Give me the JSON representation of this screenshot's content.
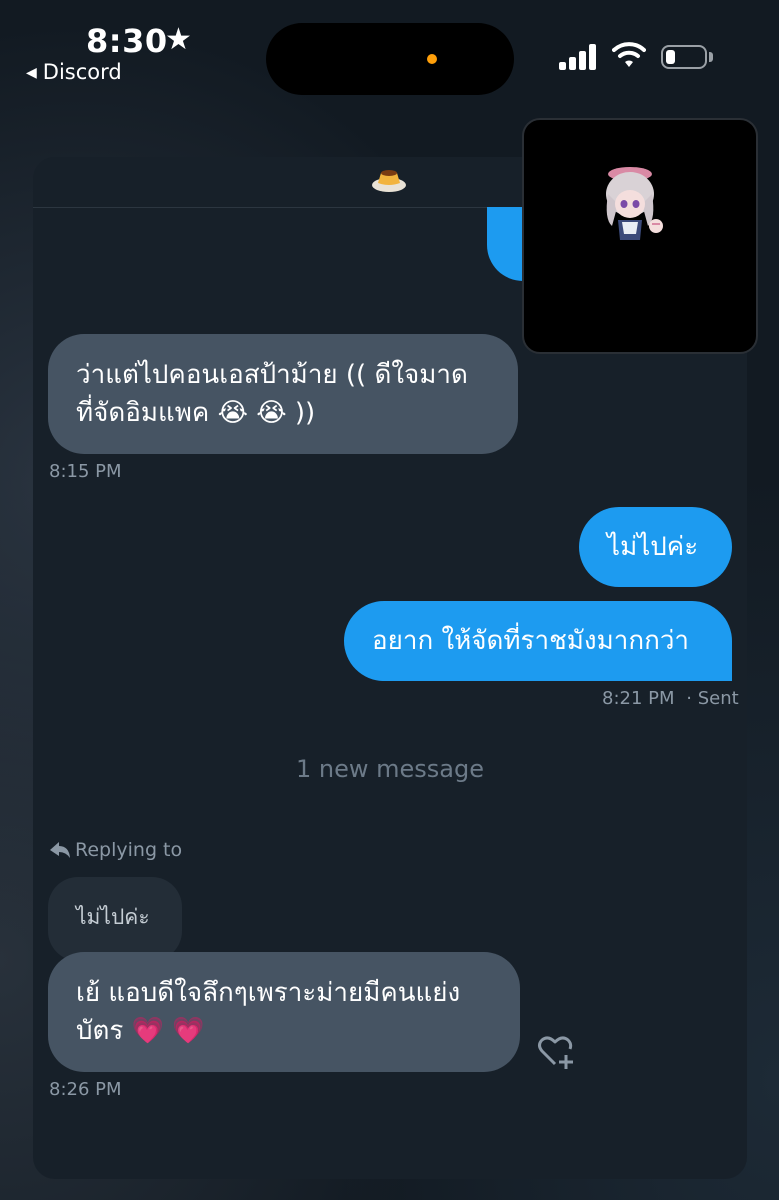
{
  "status_bar": {
    "time": "8:30",
    "star": "★",
    "back_app": "Discord",
    "dot_color": "#ff9f0a"
  },
  "header": {
    "avatar_icon": "flan-pudding-icon"
  },
  "messages": [
    {
      "direction": "in",
      "lines": [
        "ว่าแต่ไปคอนเอสป้าม้าย (( ดีใจมาด",
        "ที่จัดอิมแพค 😭 😭 ))"
      ],
      "time": "8:15 PM"
    },
    {
      "direction": "out",
      "text": "ไม่ไปค่ะ"
    },
    {
      "direction": "out",
      "text": "อยาก ให้จัดที่ราชมังมากกว่า",
      "time": "8:21 PM",
      "status": "· Sent"
    }
  ],
  "separator": "1 new message",
  "reply": {
    "label": "Replying to",
    "quoted": "ไม่ไปค่ะ",
    "lines": [
      "เย้ แอบดีใจลึกๆเพราะม่ายมีคนแย่ง",
      "บัตร 💗 💗"
    ],
    "time": "8:26 PM"
  },
  "colors": {
    "outgoing_bubble": "#1d9bf0",
    "incoming_bubble": "#465463",
    "panel": "#172029"
  }
}
